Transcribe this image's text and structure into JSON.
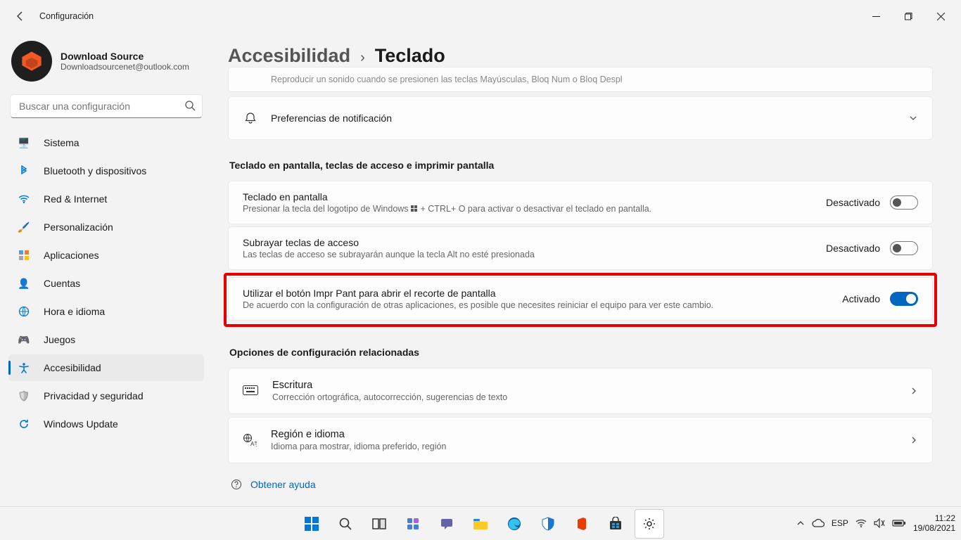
{
  "window": {
    "title": "Configuración"
  },
  "account": {
    "name": "Download Source",
    "email": "Downloadsourcenet@outlook.com"
  },
  "search": {
    "placeholder": "Buscar una configuración"
  },
  "sidebar": {
    "items": [
      {
        "label": "Sistema",
        "icon": "💻"
      },
      {
        "label": "Bluetooth y dispositivos",
        "icon": "bt"
      },
      {
        "label": "Red & Internet",
        "icon": "wifi"
      },
      {
        "label": "Personalización",
        "icon": "🖌️"
      },
      {
        "label": "Aplicaciones",
        "icon": "apps"
      },
      {
        "label": "Cuentas",
        "icon": "👤"
      },
      {
        "label": "Hora e idioma",
        "icon": "🌐"
      },
      {
        "label": "Juegos",
        "icon": "🎮"
      },
      {
        "label": "Accesibilidad",
        "icon": "acc"
      },
      {
        "label": "Privacidad y seguridad",
        "icon": "🛡️"
      },
      {
        "label": "Windows Update",
        "icon": "⟳"
      }
    ],
    "active_index": 8
  },
  "breadcrumb": {
    "parent": "Accesibilidad",
    "current": "Teclado"
  },
  "clipped_card": {
    "subtitle": "Reproducir un sonido cuando se presionen las teclas Mayúsculas, Bloq Num o Bloq Despl"
  },
  "notif_card": {
    "title": "Preferencias de notificación"
  },
  "section1_title": "Teclado en pantalla, teclas de acceso e imprimir pantalla",
  "settings": [
    {
      "title": "Teclado en pantalla",
      "desc_pre": "Presionar la tecla del logotipo de Windows ",
      "desc_post": " + CTRL+ O para activar o desactivar el teclado en pantalla.",
      "state": "Desactivado",
      "on": false
    },
    {
      "title": "Subrayar teclas de acceso",
      "desc": "Las teclas de acceso se subrayarán aunque la tecla Alt no esté presionada",
      "state": "Desactivado",
      "on": false
    },
    {
      "title": "Utilizar el botón Impr Pant para abrir el recorte de pantalla",
      "desc": "De acuerdo con la configuración de otras aplicaciones, es posible que necesites reiniciar el equipo para ver este cambio.",
      "state": "Activado",
      "on": true,
      "highlighted": true
    }
  ],
  "section2_title": "Opciones de configuración relacionadas",
  "related": [
    {
      "title": "Escritura",
      "desc": "Corrección ortográfica, autocorrección, sugerencias de texto"
    },
    {
      "title": "Región e idioma",
      "desc": "Idioma para mostrar, idioma preferido, región"
    }
  ],
  "help_link": "Obtener ayuda",
  "taskbar": {
    "lang": "ESP",
    "time": "11:22",
    "date": "19/08/2021"
  }
}
